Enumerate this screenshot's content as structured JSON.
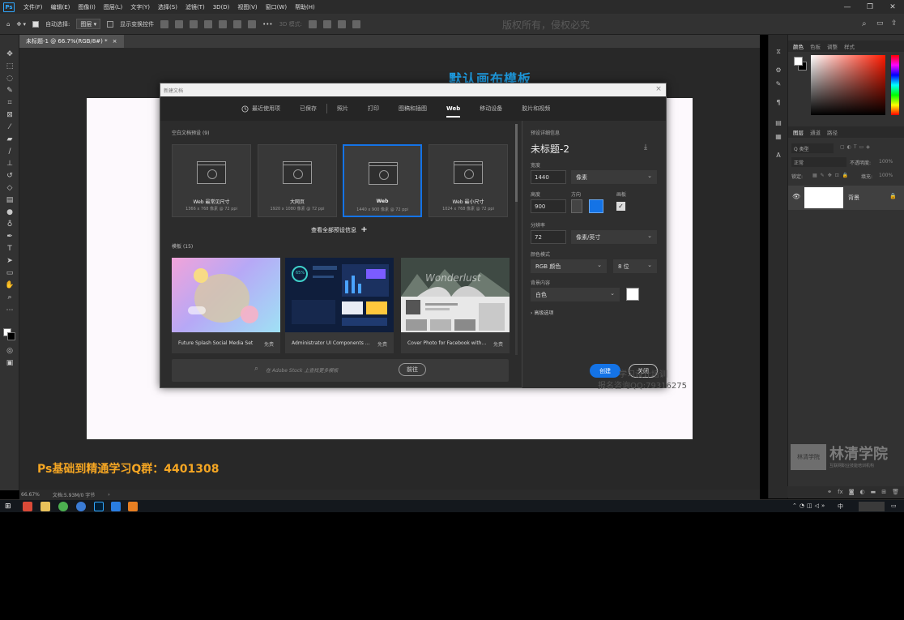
{
  "app": {
    "logo": "Ps",
    "menu": [
      "文件(F)",
      "编辑(E)",
      "图像(I)",
      "图层(L)",
      "文字(Y)",
      "选择(S)",
      "滤镜(T)",
      "3D(D)",
      "视图(V)",
      "窗口(W)",
      "帮助(H)"
    ],
    "window_controls": [
      "—",
      "❐",
      "✕"
    ]
  },
  "options_bar": {
    "auto_select_label": "自动选择:",
    "auto_select_value": "图层",
    "show_transform_label": "显示变换控件",
    "mode_3d_label": "3D 模式:",
    "ellipsis": "•••"
  },
  "watermark_top": "版权所有，侵权必究",
  "doc_tab": {
    "label": "未标题-1 @ 66.7%(RGB/8#) *",
    "close": "×"
  },
  "overlay": {
    "heading": "默认画布模板",
    "qq_group": "Ps基础到精通学习Q群：4401308",
    "wm_line1": "学习设计培训",
    "wm_line2": "报名咨询QQ:79316275",
    "highlight_color": "#1e9be0"
  },
  "dialog": {
    "title": "新建文档",
    "close": "×",
    "tabs": [
      {
        "label": "最近使用项",
        "icon": "clock-icon"
      },
      {
        "label": "已保存"
      },
      {
        "label": "照片"
      },
      {
        "label": "打印"
      },
      {
        "label": "图稿和插图"
      },
      {
        "label": "Web",
        "active": true
      },
      {
        "label": "移动设备"
      },
      {
        "label": "胶片和视频"
      }
    ],
    "blank_presets": {
      "heading": "空白文档预设",
      "count": "(9)",
      "items": [
        {
          "name": "Web 最常见尺寸",
          "dims": "1366 x 768 像素 @ 72 ppi"
        },
        {
          "name": "大网页",
          "dims": "1920 x 1080 像素 @ 72 ppi"
        },
        {
          "name": "Web",
          "dims": "1440 x 900 像素 @ 72 ppi",
          "selected": true
        },
        {
          "name": "Web 最小尺寸",
          "dims": "1024 x 768 像素 @ 72 ppi"
        }
      ],
      "view_all": "查看全部预设信息",
      "plus": "+"
    },
    "templates": {
      "heading": "模板",
      "count": "(15)",
      "items": [
        {
          "name": "Future Splash Social Media Set",
          "price": "免费"
        },
        {
          "name": "Administrator UI Components Set",
          "price": "免费"
        },
        {
          "name": "Cover Photo for Facebook with I...",
          "price": "免费"
        }
      ],
      "stat_65": "65%",
      "wonder_text": "Wonderlust"
    },
    "search": {
      "placeholder": "在 Adobe Stock 上查找更多模板",
      "go": "前往"
    },
    "details": {
      "header": "预设详细信息",
      "name": "未标题-2",
      "width_label": "宽度",
      "width": "1440",
      "width_unit": "像素",
      "height_label": "高度",
      "height": "900",
      "orientation_label": "方向",
      "artboard_label": "画板",
      "resolution_label": "分辨率",
      "resolution": "72",
      "resolution_unit": "像素/英寸",
      "color_mode_label": "颜色模式",
      "color_mode": "RGB 颜色",
      "bit_depth": "8 位",
      "bg_label": "背景内容",
      "bg": "白色",
      "advanced": "高级选项"
    },
    "buttons": {
      "create": "创建",
      "close": "关闭"
    }
  },
  "status": {
    "zoom": "66.67%",
    "doc": "文档:5.93M/0 字节",
    "arrow": "›"
  },
  "right_panel": {
    "color_tabs": [
      "颜色",
      "色板",
      "调整",
      "样式"
    ],
    "layer_tabs": [
      "图层",
      "通道",
      "路径"
    ],
    "kind": "Q 类型",
    "blend": "正常",
    "opacity_label": "不透明度:",
    "opacity": "100%",
    "lock_label": "锁定:",
    "fill_label": "填充:",
    "fill": "100%",
    "layer_name": "背景"
  },
  "logo": {
    "badge": "林清学院",
    "name": "林清学院",
    "tagline": "互联网职业技能培训机构"
  },
  "taskbar": {
    "ime": "中"
  }
}
